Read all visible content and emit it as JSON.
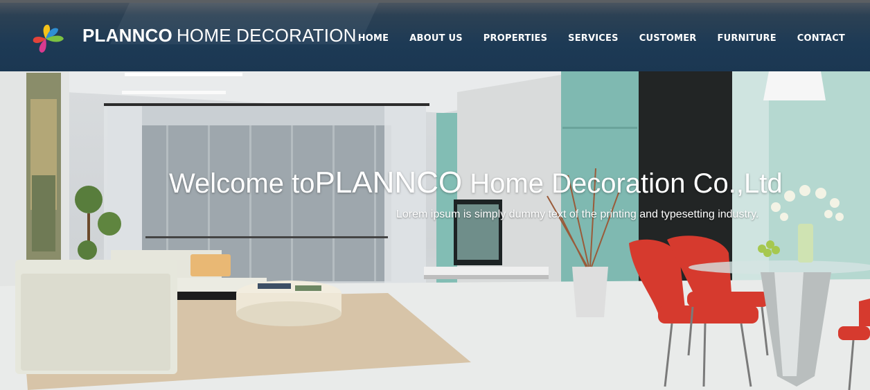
{
  "brand": {
    "name_bold": "PLANNCO",
    "name_light": "HOME DECORATION"
  },
  "nav": {
    "items": [
      "HOME",
      "ABOUT US",
      "PROPERTIES",
      "SERVICES",
      "CUSTOMER",
      "FURNITURE",
      "CONTACT"
    ]
  },
  "hero": {
    "title_prefix": "Welcome to",
    "title_brand": "PLANNCO",
    "title_suffix": " Home Decoration Co.,Ltd",
    "subtitle": "Lorem ipsum is simply dummy text of the printing and typesetting industry."
  },
  "colors": {
    "header_bg": "#1b3752",
    "nav_text": "#ffffff",
    "chair_red": "#d63a2e",
    "wall_teal": "#7fb9b1"
  },
  "icons": {
    "logo": "pinwheel-logo-icon"
  }
}
